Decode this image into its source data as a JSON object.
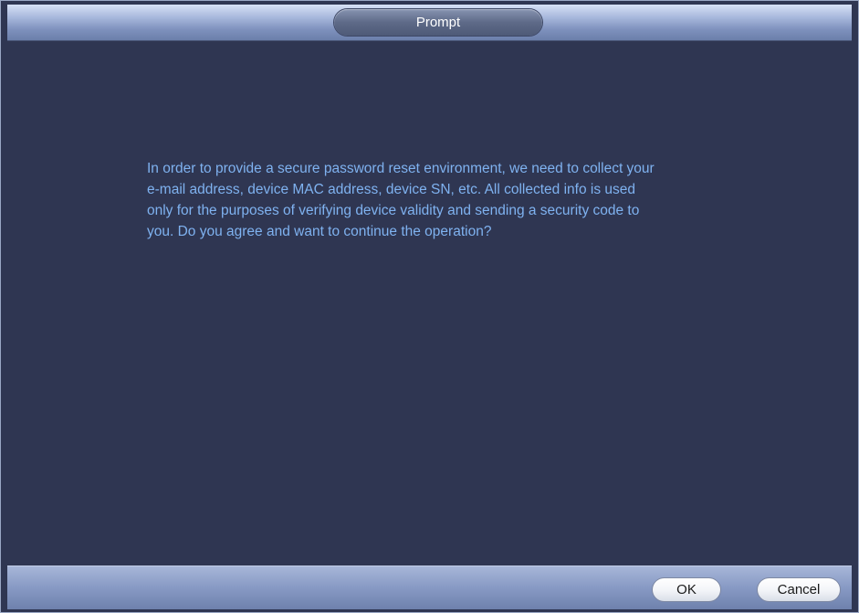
{
  "dialog": {
    "title": "Prompt",
    "message": "In order to provide a secure password reset environment, we need to collect your\ne-mail address, device MAC address, device SN, etc. All collected info is used\nonly for the purposes of verifying device validity and sending a security code to\nyou. Do you agree and want to continue the operation?"
  },
  "buttons": {
    "ok_label": "OK",
    "cancel_label": "Cancel"
  }
}
